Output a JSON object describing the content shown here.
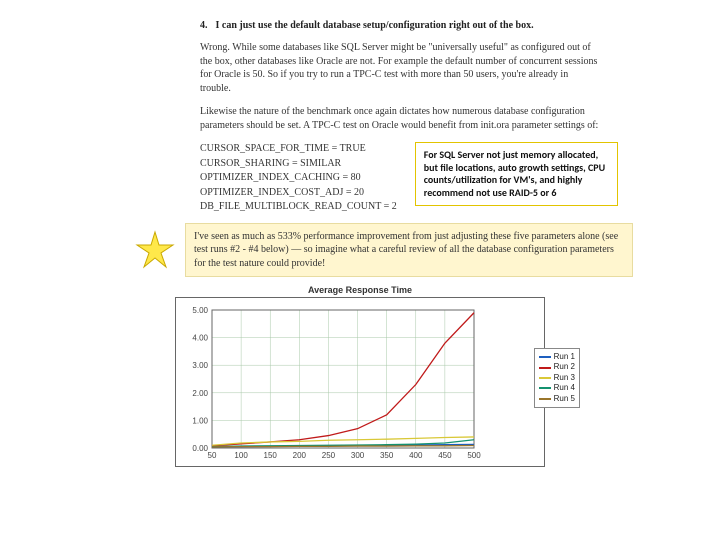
{
  "heading": {
    "num": "4.",
    "title": "I can just use the default database setup/configuration right out of the box."
  },
  "para1": "Wrong. While some databases like SQL Server might be \"universally useful\" as configured out of the box, other databases like Oracle are not. For example the default number of concurrent sessions for Oracle is 50. So if you try to run a TPC-C test with more than 50 users, you're already in trouble.",
  "para2": "Likewise the nature of the benchmark once again dictates how numerous database configuration parameters should be set. A TPC-C test on Oracle would benefit from init.ora parameter settings of:",
  "params": [
    "CURSOR_SPACE_FOR_TIME = TRUE",
    "CURSOR_SHARING = SIMILAR",
    "OPTIMIZER_INDEX_CACHING = 80",
    "OPTIMIZER_INDEX_COST_ADJ = 20",
    "DB_FILE_MULTIBLOCK_READ_COUNT = 2"
  ],
  "callout": "For SQL Server not just memory allocated, but file locations, auto growth settings, CPU counts/utilization for VM's, and highly recommend not use RAID-5 or 6",
  "note": "I've seen as much as 533% performance improvement from just adjusting these five parameters alone (see test runs #2 - #4 below) — so imagine what a careful review of all the database configuration parameters for the test nature could provide!",
  "chart_data": {
    "type": "line",
    "title": "Average Response Time",
    "x": [
      50,
      100,
      150,
      200,
      250,
      300,
      350,
      400,
      450,
      500
    ],
    "xlim": [
      50,
      500
    ],
    "ylim": [
      0,
      5.0
    ],
    "yticks": [
      0.0,
      1.0,
      2.0,
      3.0,
      4.0,
      5.0
    ],
    "series": [
      {
        "name": "Run 1",
        "color": "#1e5fbf",
        "values": [
          0.05,
          0.05,
          0.06,
          0.07,
          0.08,
          0.09,
          0.1,
          0.11,
          0.12,
          0.13
        ]
      },
      {
        "name": "Run 2",
        "color": "#c01a1a",
        "values": [
          0.08,
          0.15,
          0.22,
          0.3,
          0.45,
          0.7,
          1.2,
          2.3,
          3.8,
          4.9
        ]
      },
      {
        "name": "Run 3",
        "color": "#d9c837",
        "values": [
          0.1,
          0.18,
          0.22,
          0.24,
          0.28,
          0.3,
          0.32,
          0.35,
          0.38,
          0.4
        ]
      },
      {
        "name": "Run 4",
        "color": "#14926f",
        "values": [
          0.05,
          0.07,
          0.08,
          0.09,
          0.1,
          0.11,
          0.12,
          0.14,
          0.18,
          0.3
        ]
      },
      {
        "name": "Run 5",
        "color": "#9a752b",
        "values": [
          0.04,
          0.05,
          0.05,
          0.06,
          0.06,
          0.07,
          0.07,
          0.08,
          0.08,
          0.09
        ]
      }
    ]
  }
}
